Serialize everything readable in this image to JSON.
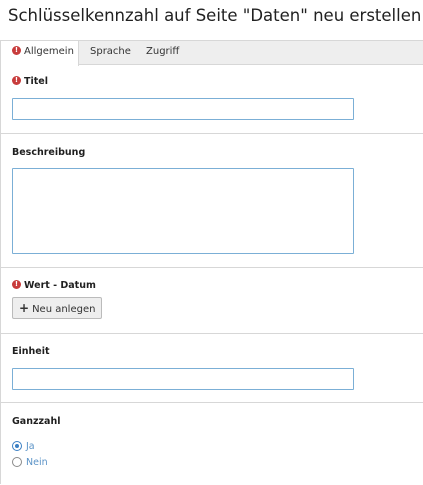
{
  "page": {
    "title": "Schlüsselkennzahl auf Seite \"Daten\" neu erstellen"
  },
  "tabs": [
    {
      "label": "Allgemein",
      "active": true,
      "has_error": true
    },
    {
      "label": "Sprache",
      "active": false,
      "has_error": false
    },
    {
      "label": "Zugriff",
      "active": false,
      "has_error": false
    }
  ],
  "fields": {
    "titel": {
      "label": "Titel",
      "required_error": true,
      "value": ""
    },
    "beschreibung": {
      "label": "Beschreibung",
      "value": ""
    },
    "wert_datum": {
      "label": "Wert - Datum",
      "required_error": true,
      "new_button_label": "Neu anlegen"
    },
    "einheit": {
      "label": "Einheit",
      "value": ""
    },
    "ganzzahl": {
      "label": "Ganzzahl",
      "options": [
        {
          "label": "Ja",
          "checked": true
        },
        {
          "label": "Nein",
          "checked": false
        }
      ]
    }
  },
  "icons": {
    "error": "exclamation-circle-icon",
    "plus": "plus-icon",
    "error_glyph": "!",
    "plus_glyph": "+"
  },
  "colors": {
    "error_red": "#c83c3c",
    "input_border_blue": "#7bafd6",
    "radio_label_blue": "#5b93c7",
    "tab_bar_bg": "#eeeeee"
  }
}
